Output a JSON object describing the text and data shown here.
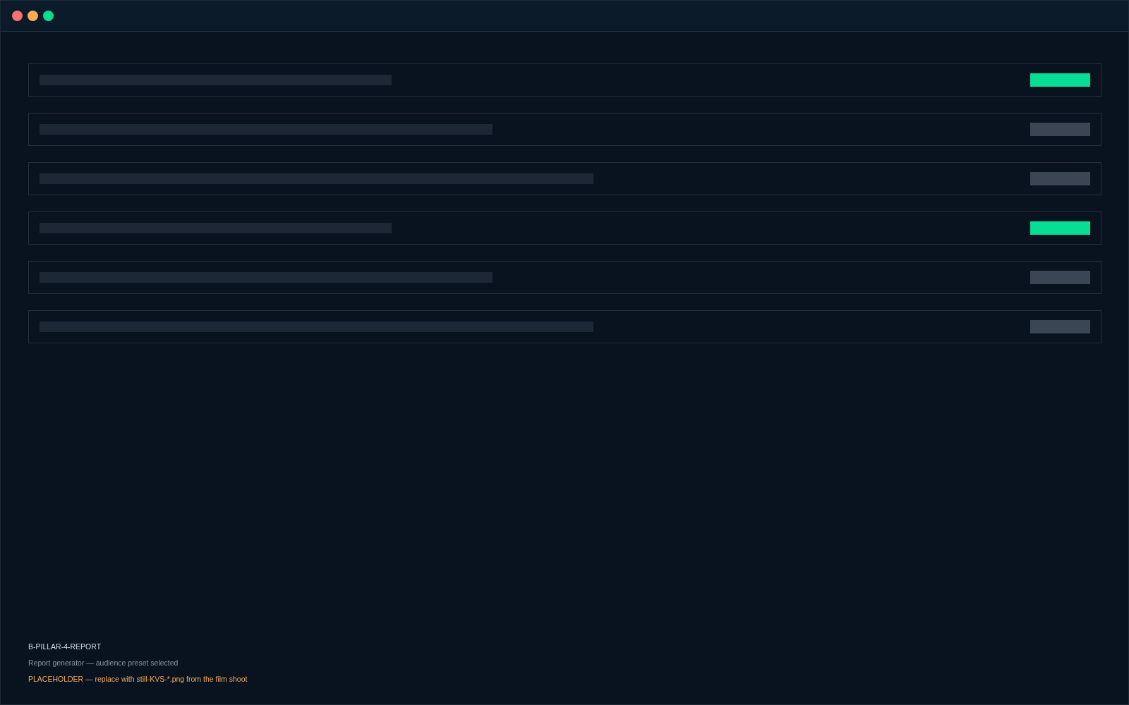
{
  "rows": [
    {
      "kind": "short",
      "selected": true
    },
    {
      "kind": "medium",
      "selected": false
    },
    {
      "kind": "long",
      "selected": false
    },
    {
      "kind": "short",
      "selected": true
    },
    {
      "kind": "medium",
      "selected": false
    },
    {
      "kind": "long",
      "selected": false
    }
  ],
  "footer": {
    "title": "B-PILLAR-4-REPORT",
    "status": "Report generator — audience preset selected",
    "note": "PLACEHOLDER — replace with still-KVS-*.png from the film shoot"
  }
}
